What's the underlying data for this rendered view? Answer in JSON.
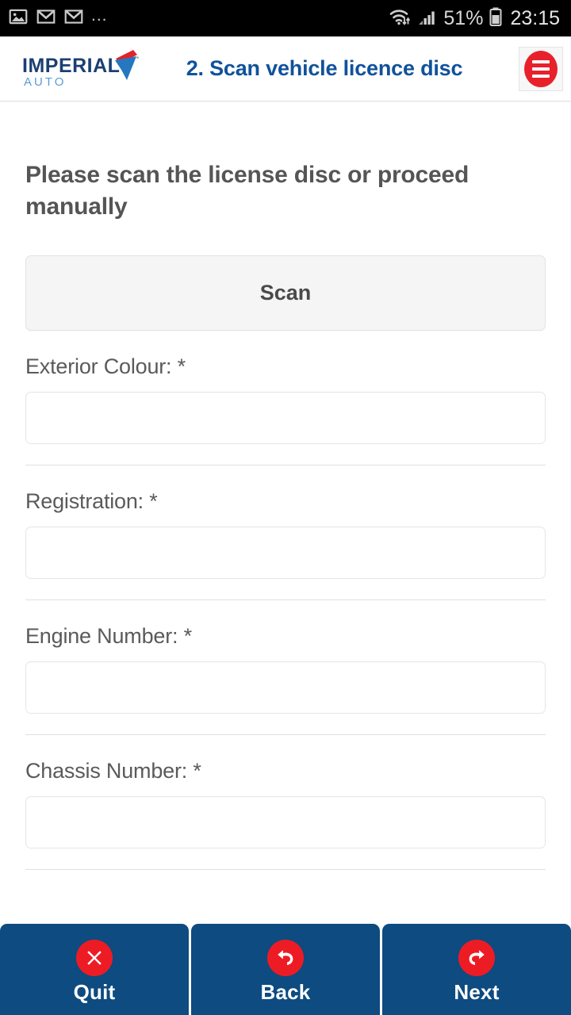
{
  "status_bar": {
    "left_icons": [
      "photo-icon",
      "gmail-icon",
      "gmail-icon",
      "overflow-dots"
    ],
    "overflow": "...",
    "right_icons": [
      "wifi-icon",
      "cellular-signal-icon",
      "battery-icon"
    ],
    "battery_percent": "51%",
    "time": "23:15"
  },
  "header": {
    "logo_word": "IMPERIAL",
    "logo_sub": "AUTO",
    "title": "2. Scan vehicle licence disc",
    "menu_icon": "hamburger-icon",
    "title_color": "#10529b",
    "logo_color": "#1b3f72",
    "accent_red": "#e8202b"
  },
  "main": {
    "heading": "Please scan the license disc or proceed manually",
    "scan_button": "Scan",
    "fields": [
      {
        "label": "Exterior Colour: *",
        "value": "",
        "placeholder": ""
      },
      {
        "label": "Registration: *",
        "value": "",
        "placeholder": ""
      },
      {
        "label": "Engine Number: *",
        "value": "",
        "placeholder": ""
      },
      {
        "label": "Chassis Number: *",
        "value": "",
        "placeholder": ""
      }
    ]
  },
  "bottom_nav": {
    "background": "#0d4b80",
    "icon_color": "#ed1c24",
    "buttons": [
      {
        "label": "Quit",
        "icon": "close-x-icon"
      },
      {
        "label": "Back",
        "icon": "undo-arrow-icon"
      },
      {
        "label": "Next",
        "icon": "redo-arrow-icon"
      }
    ]
  }
}
